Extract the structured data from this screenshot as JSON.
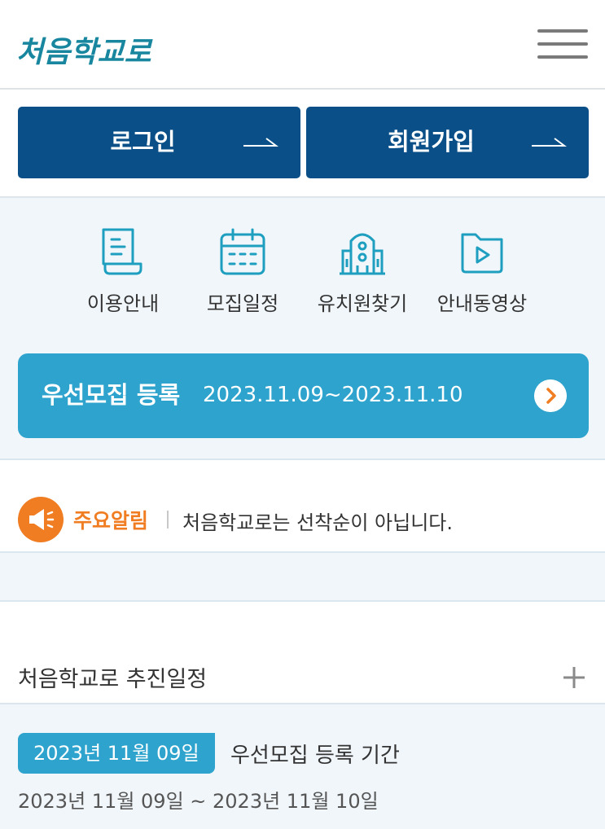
{
  "header": {
    "logo_text": "처음학교로",
    "menu_icon": "hamburger-menu-icon"
  },
  "auth": {
    "login_label": "로그인",
    "signup_label": "회원가입"
  },
  "quick_menu": [
    {
      "label": "이용안내",
      "icon": "document-guide-icon"
    },
    {
      "label": "모집일정",
      "icon": "calendar-icon"
    },
    {
      "label": "유치원찾기",
      "icon": "building-icon"
    },
    {
      "label": "안내동영상",
      "icon": "video-play-icon"
    }
  ],
  "banner": {
    "title": "우선모집 등록",
    "date_range": "2023.11.09~2023.11.10"
  },
  "notice": {
    "tag": "주요알림",
    "text": "처음학교로는 선착순이 아닙니다."
  },
  "schedule": {
    "title": "처음학교로 추진일정",
    "items": [
      {
        "date_badge": "2023년 11월 09일",
        "name": "우선모집 등록 기간",
        "range": "2023년 11월 09일 ~ 2023년 11월 10일"
      }
    ]
  },
  "colors": {
    "primary_navy": "#0a4f87",
    "accent_blue": "#2ea3cd",
    "notice_orange": "#f07d21",
    "icon_teal": "#1f9fc0",
    "logo_teal": "#17869e"
  }
}
